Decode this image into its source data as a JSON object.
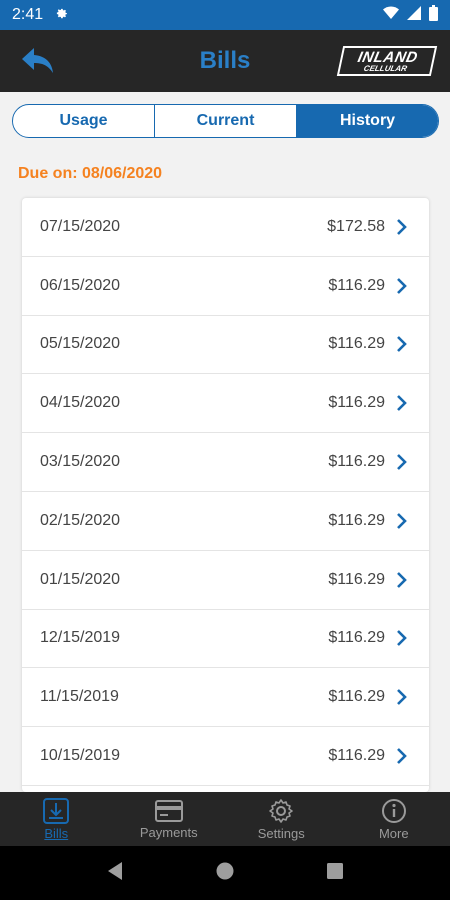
{
  "status_bar": {
    "time": "2:41"
  },
  "header": {
    "title": "Bills",
    "brand_line1": "INLAND",
    "brand_line2": "CELLULAR"
  },
  "tabs": [
    {
      "label": "Usage",
      "active": false
    },
    {
      "label": "Current",
      "active": false
    },
    {
      "label": "History",
      "active": true
    }
  ],
  "due_label": "Due on: 08/06/2020",
  "bills": [
    {
      "date": "07/15/2020",
      "amount": "$172.58"
    },
    {
      "date": "06/15/2020",
      "amount": "$116.29"
    },
    {
      "date": "05/15/2020",
      "amount": "$116.29"
    },
    {
      "date": "04/15/2020",
      "amount": "$116.29"
    },
    {
      "date": "03/15/2020",
      "amount": "$116.29"
    },
    {
      "date": "02/15/2020",
      "amount": "$116.29"
    },
    {
      "date": "01/15/2020",
      "amount": "$116.29"
    },
    {
      "date": "12/15/2019",
      "amount": "$116.29"
    },
    {
      "date": "11/15/2019",
      "amount": "$116.29"
    },
    {
      "date": "10/15/2019",
      "amount": "$116.29"
    }
  ],
  "bottom_nav": [
    {
      "label": "Bills",
      "icon": "bill-download-icon",
      "active": true
    },
    {
      "label": "Payments",
      "icon": "card-icon",
      "active": false
    },
    {
      "label": "Settings",
      "icon": "gear-icon",
      "active": false
    },
    {
      "label": "More",
      "icon": "info-icon",
      "active": false
    }
  ],
  "colors": {
    "primary": "#1769b0",
    "accent": "#f58220",
    "header_bg": "#262626"
  }
}
